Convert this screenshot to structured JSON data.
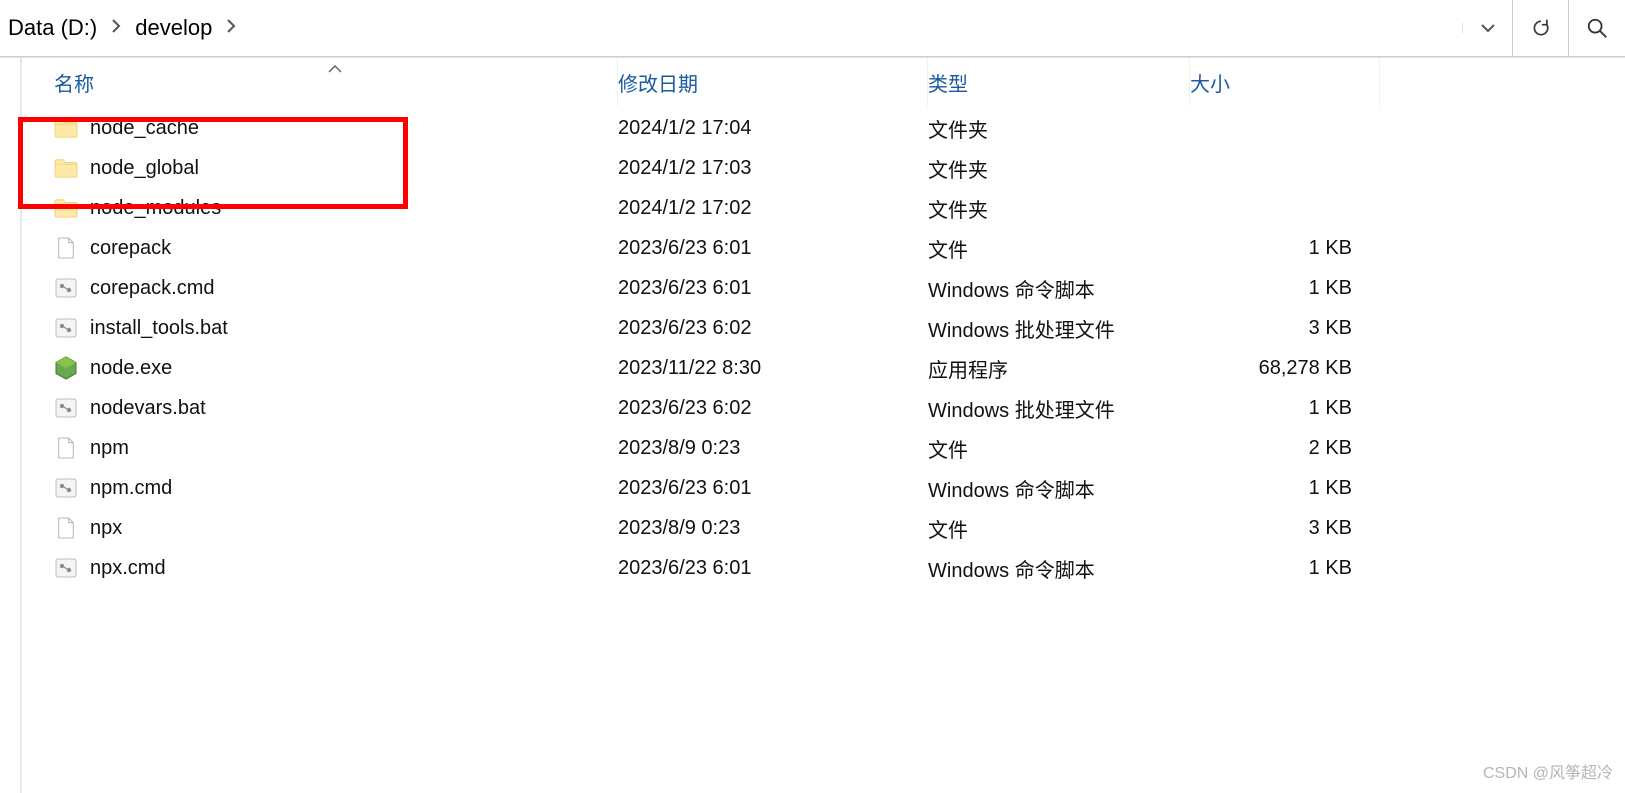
{
  "breadcrumb": {
    "segments": [
      "Data (D:)",
      "develop"
    ]
  },
  "columns": {
    "name": "名称",
    "date": "修改日期",
    "type": "类型",
    "size": "大小"
  },
  "icon_types": {
    "folder": "folder-icon",
    "file": "file-icon",
    "cmd": "cmd-script-icon",
    "bat": "bat-script-icon",
    "exe": "node-exe-icon"
  },
  "rows": [
    {
      "icon": "folder",
      "name": "node_cache",
      "date": "2024/1/2 17:04",
      "type": "文件夹",
      "size": ""
    },
    {
      "icon": "folder",
      "name": "node_global",
      "date": "2024/1/2 17:03",
      "type": "文件夹",
      "size": ""
    },
    {
      "icon": "folder",
      "name": "node_modules",
      "date": "2024/1/2 17:02",
      "type": "文件夹",
      "size": ""
    },
    {
      "icon": "file",
      "name": "corepack",
      "date": "2023/6/23 6:01",
      "type": "文件",
      "size": "1 KB"
    },
    {
      "icon": "cmd",
      "name": "corepack.cmd",
      "date": "2023/6/23 6:01",
      "type": "Windows 命令脚本",
      "size": "1 KB"
    },
    {
      "icon": "cmd",
      "name": "install_tools.bat",
      "date": "2023/6/23 6:02",
      "type": "Windows 批处理文件",
      "size": "3 KB"
    },
    {
      "icon": "exe",
      "name": "node.exe",
      "date": "2023/11/22 8:30",
      "type": "应用程序",
      "size": "68,278 KB"
    },
    {
      "icon": "cmd",
      "name": "nodevars.bat",
      "date": "2023/6/23 6:02",
      "type": "Windows 批处理文件",
      "size": "1 KB"
    },
    {
      "icon": "file",
      "name": "npm",
      "date": "2023/8/9 0:23",
      "type": "文件",
      "size": "2 KB"
    },
    {
      "icon": "cmd",
      "name": "npm.cmd",
      "date": "2023/6/23 6:01",
      "type": "Windows 命令脚本",
      "size": "1 KB"
    },
    {
      "icon": "file",
      "name": "npx",
      "date": "2023/8/9 0:23",
      "type": "文件",
      "size": "3 KB"
    },
    {
      "icon": "cmd",
      "name": "npx.cmd",
      "date": "2023/6/23 6:01",
      "type": "Windows 命令脚本",
      "size": "1 KB"
    }
  ],
  "watermark": "CSDN @风筝超冷"
}
